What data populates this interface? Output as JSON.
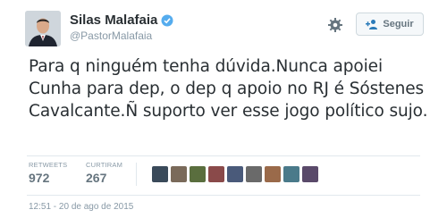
{
  "user": {
    "name": "Silas Malafaia",
    "handle": "@PastorMalafaia"
  },
  "actions": {
    "follow_label": "Seguir",
    "follow_icon": "add-user-icon",
    "settings_icon": "gear-icon"
  },
  "tweet": {
    "text": "Para q ninguém tenha dúvida.Nunca apoiei Cunha para dep, o dep q apoio no RJ é Sóstenes Cavalcante.Ñ suporto ver esse jogo político sujo."
  },
  "stats": {
    "retweets_label": "RETWEETS",
    "retweets_value": "972",
    "likes_label": "CURTIRAM",
    "likes_value": "267"
  },
  "liker_colors": [
    "#3a4a5a",
    "#7a6a5a",
    "#5a6e3e",
    "#8a4a4a",
    "#4a5a7a",
    "#6a6a6a",
    "#9a6a4a",
    "#4a7a8a",
    "#5a4a6a"
  ],
  "timestamp": "12:51 - 20 de ago de 2015",
  "colors": {
    "accent": "#2b7bb9",
    "verified": "#55acee",
    "text": "#292f33",
    "muted": "#8899a6"
  }
}
